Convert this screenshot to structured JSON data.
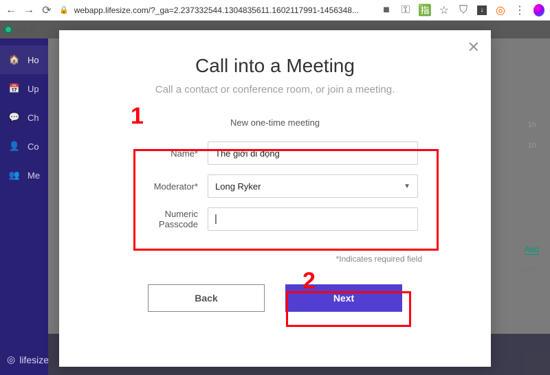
{
  "browser": {
    "url": "webapp.lifesize.com/?_ga=2.237332544.1304835611.1602117991-1456348..."
  },
  "topbar": {
    "my_text": "My E"
  },
  "sidebar": {
    "items": [
      {
        "label": "Ho"
      },
      {
        "label": "Up"
      },
      {
        "label": "Ch"
      },
      {
        "label": "Co"
      },
      {
        "label": "Me"
      }
    ],
    "logo_text": "lifesize"
  },
  "bg": {
    "row1": "1h",
    "row2": "1h",
    "add": "Add",
    "appear": "opear"
  },
  "modal": {
    "title": "Call into a Meeting",
    "subtitle": "Call a contact or conference room, or join a meeting.",
    "section": "New one-time meeting",
    "labels": {
      "name": "Name*",
      "moderator": "Moderator*",
      "passcode1": "Numeric",
      "passcode2": "Passcode"
    },
    "values": {
      "name": "Thế giới di động",
      "moderator": "Long Ryker",
      "passcode": ""
    },
    "required_note": "*Indicates required field",
    "back": "Back",
    "next": "Next"
  },
  "annotations": {
    "one": "1",
    "two": "2"
  }
}
